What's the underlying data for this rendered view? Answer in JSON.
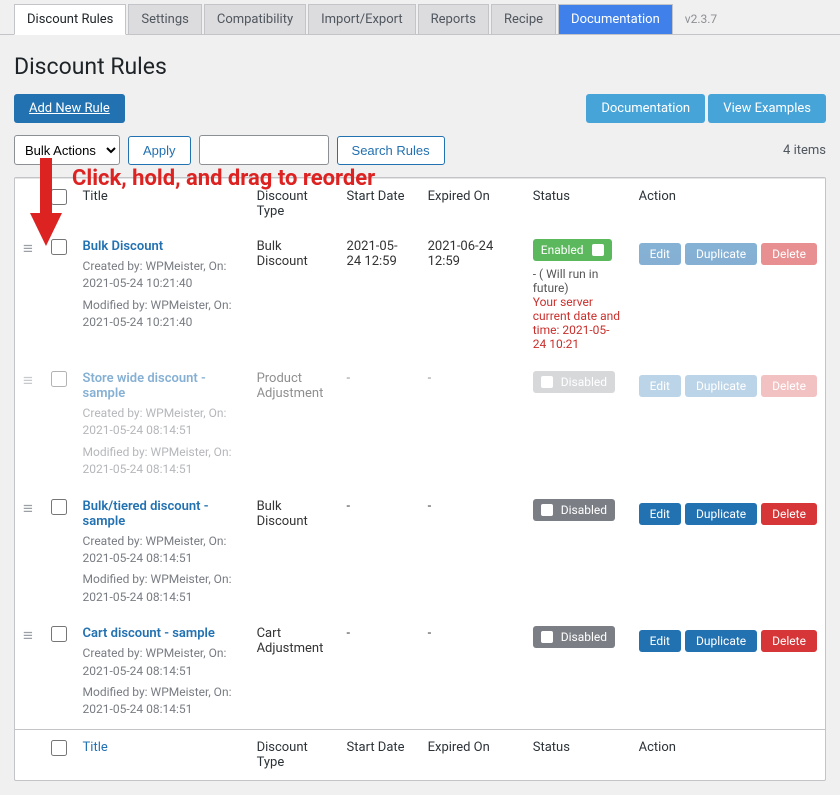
{
  "tabs": {
    "items": [
      "Discount Rules",
      "Settings",
      "Compatibility",
      "Import/Export",
      "Reports",
      "Recipe",
      "Documentation"
    ],
    "active": 0,
    "doc_index": 6
  },
  "version": "v2.3.7",
  "page_title": "Discount Rules",
  "buttons": {
    "add_new": "Add New Rule",
    "documentation": "Documentation",
    "view_examples": "View Examples",
    "apply": "Apply",
    "search": "Search Rules"
  },
  "bulk_select": {
    "label": "Bulk Actions"
  },
  "items_count": "4 items",
  "columns": {
    "title": "Title",
    "discount": "Discount Type",
    "start": "Start Date",
    "expired": "Expired On",
    "status": "Status",
    "action": "Action"
  },
  "footer": {
    "title": "Title",
    "discount": "Discount Type",
    "start": "Start Date",
    "expired": "Expired On",
    "status": "Status",
    "action": "Action"
  },
  "action_labels": {
    "edit": "Edit",
    "duplicate": "Duplicate",
    "delete": "Delete"
  },
  "status_labels": {
    "enabled": "Enabled",
    "disabled": "Disabled"
  },
  "future_note": {
    "prefix": "- ( Will run in future)",
    "line2": "Your server current date and time: 2021-05-24 10:21"
  },
  "overlay": {
    "text": "Click, hold, and drag to reorder"
  },
  "rules": [
    {
      "title": "Bulk Discount",
      "created": "Created by: WPMeister, On: 2021-05-24 10:21:40",
      "modified": "Modified by: WPMeister, On: 2021-05-24 10:21:40",
      "discount": "Bulk Discount",
      "start": "2021-05-24 12:59",
      "expired": "2021-06-24 12:59",
      "status": "enabled",
      "future": true,
      "ghost_actions": true
    },
    {
      "title": "Store wide discount - sample",
      "created": "Created by: WPMeister, On: 2021-05-24 08:14:51",
      "modified": "Modified by: WPMeister, On: 2021-05-24 08:14:51",
      "discount": "Product Adjustment",
      "start": "-",
      "expired": "-",
      "status": "disabled",
      "ghost_row": true,
      "ghost_actions": true
    },
    {
      "title": "Bulk/tiered discount - sample",
      "created": "Created by: WPMeister, On: 2021-05-24 08:14:51",
      "modified": "Modified by: WPMeister, On: 2021-05-24 08:14:51",
      "discount": "Bulk Discount",
      "start": "-",
      "expired": "-",
      "status": "disabled"
    },
    {
      "title": "Cart discount - sample",
      "created": "Created by: WPMeister, On: 2021-05-24 08:14:51",
      "modified": "Modified by: WPMeister, On: 2021-05-24 08:14:51",
      "discount": "Cart Adjustment",
      "start": "-",
      "expired": "-",
      "status": "disabled"
    }
  ]
}
